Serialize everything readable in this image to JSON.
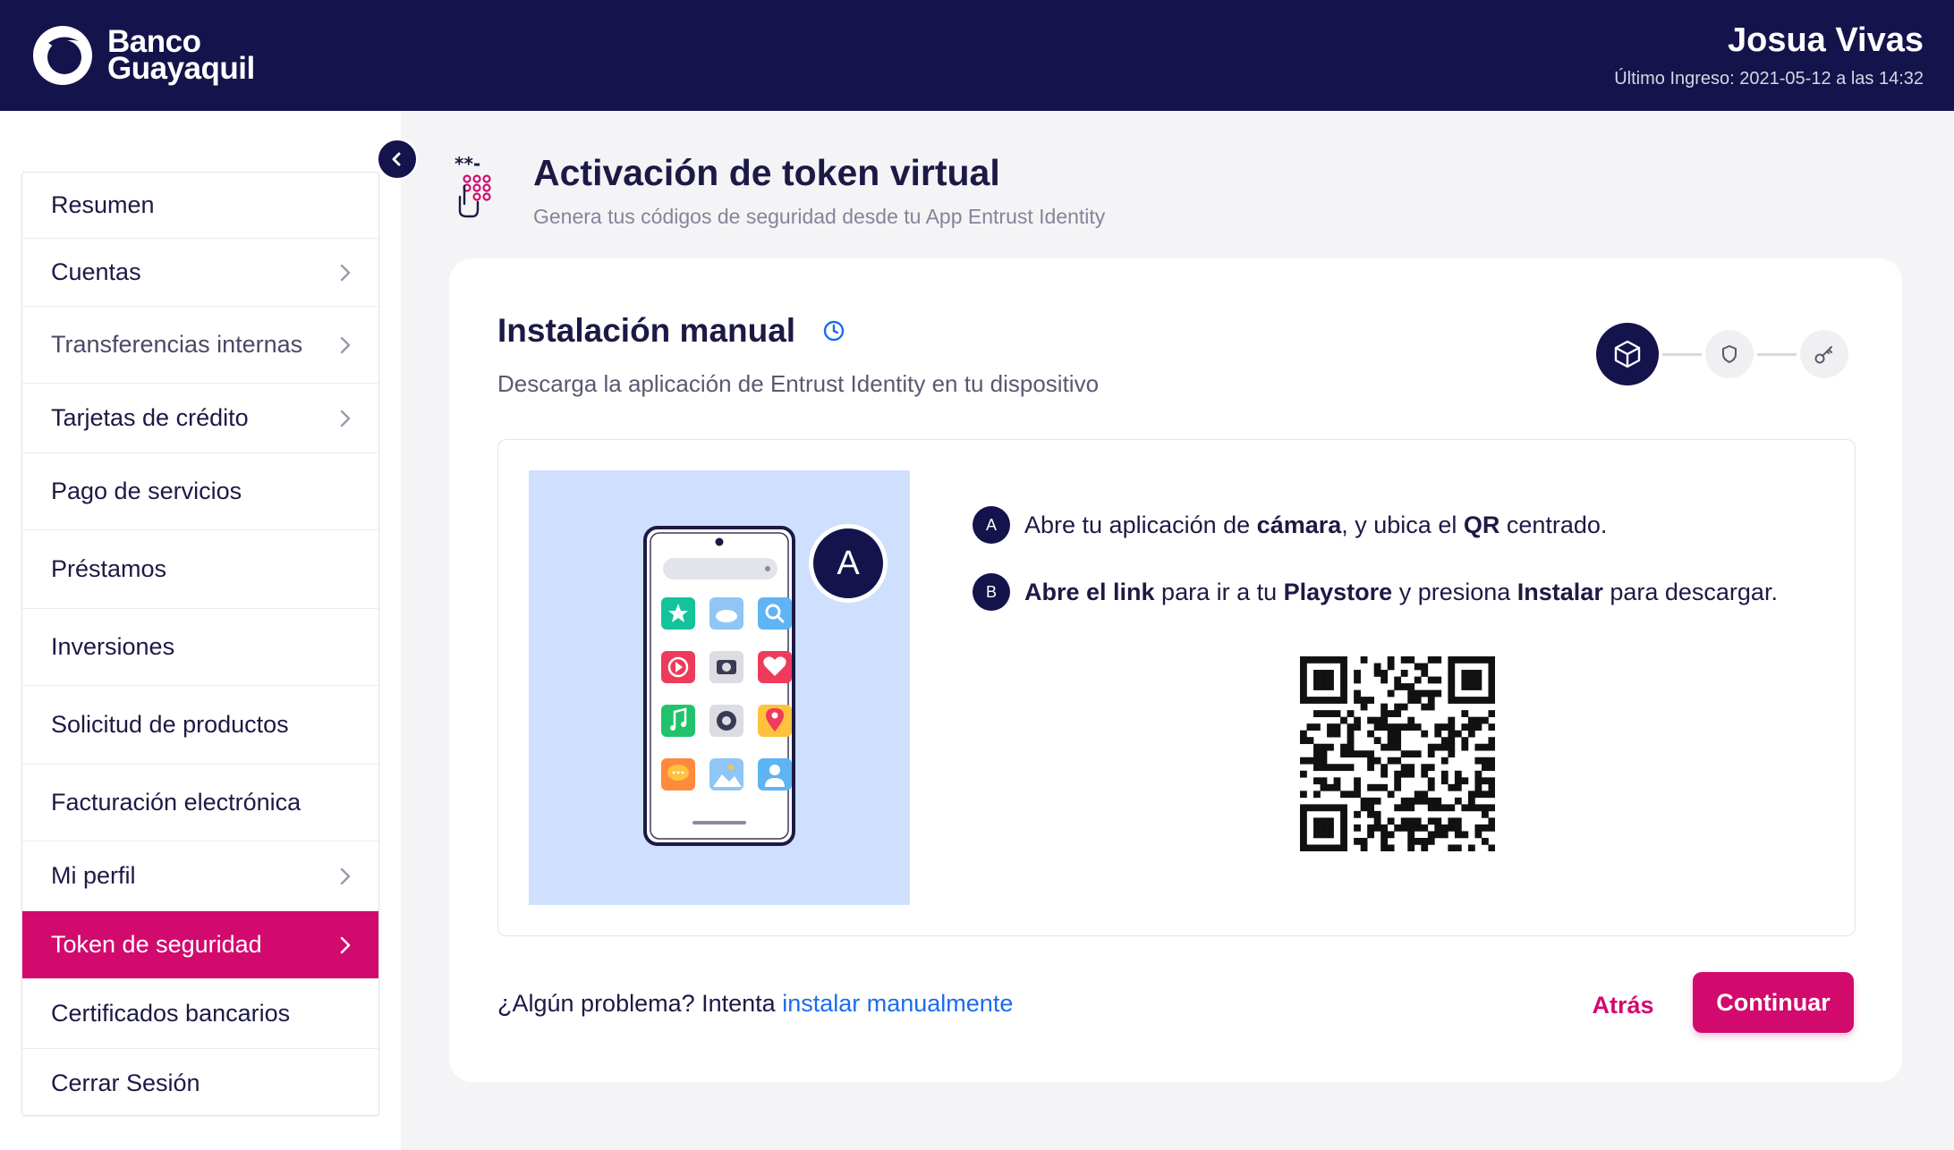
{
  "brand": {
    "line1": "Banco",
    "line2": "Guayaquil"
  },
  "user": {
    "name": "Josua Vivas",
    "last_login": "Último Ingreso: 2021-05-12 a las 14:32"
  },
  "sidebar": {
    "items": [
      {
        "label": "Resumen",
        "chevron": false,
        "active": false,
        "muted": false
      },
      {
        "label": "Cuentas",
        "chevron": true,
        "active": false,
        "muted": false
      },
      {
        "label": "Transferencias internas",
        "chevron": true,
        "active": false,
        "muted": true
      },
      {
        "label": "Tarjetas de crédito",
        "chevron": true,
        "active": false,
        "muted": false
      },
      {
        "label": "Pago de servicios",
        "chevron": false,
        "active": false,
        "muted": false
      },
      {
        "label": "Préstamos",
        "chevron": false,
        "active": false,
        "muted": false
      },
      {
        "label": "Inversiones",
        "chevron": false,
        "active": false,
        "muted": false
      },
      {
        "label": "Solicitud de productos",
        "chevron": false,
        "active": false,
        "muted": false
      },
      {
        "label": "Facturación electrónica",
        "chevron": false,
        "active": false,
        "muted": false
      },
      {
        "label": "Mi perfil",
        "chevron": true,
        "active": false,
        "muted": false
      },
      {
        "label": "Token de seguridad",
        "chevron": true,
        "active": true,
        "muted": false
      },
      {
        "label": "Certificados bancarios",
        "chevron": false,
        "active": false,
        "muted": false
      },
      {
        "label": "Cerrar Sesión",
        "chevron": false,
        "active": false,
        "muted": false
      }
    ]
  },
  "page": {
    "title": "Activación de token virtual",
    "subtitle": "Genera tus códigos de seguridad desde tu App Entrust Identity"
  },
  "card": {
    "title": "Instalación manual",
    "subtitle": "Descarga la aplicación de Entrust Identity en tu dispositivo",
    "illustration_badge": "A",
    "steps": [
      {
        "badge": "A",
        "parts": [
          {
            "t": "Abre tu aplicación de ",
            "b": false
          },
          {
            "t": "cámara",
            "b": true
          },
          {
            "t": ", y ubica el ",
            "b": false
          },
          {
            "t": "QR",
            "b": true
          },
          {
            "t": " centrado.",
            "b": false
          }
        ]
      },
      {
        "badge": "B",
        "parts": [
          {
            "t": "Abre el link",
            "b": true
          },
          {
            "t": " para ir a tu ",
            "b": false
          },
          {
            "t": "Playstore",
            "b": true
          },
          {
            "t": " y presiona ",
            "b": false
          },
          {
            "t": "Instalar",
            "b": true
          },
          {
            "t": " para descargar.",
            "b": false
          }
        ]
      }
    ]
  },
  "footer": {
    "problem_text": "¿Algún problema? Intenta ",
    "problem_link": "instalar manualmente",
    "back_label": "Atrás",
    "continue_label": "Continuar"
  },
  "colors": {
    "navy": "#15134b",
    "magenta": "#d20a6d",
    "link": "#1b6bf0",
    "illus_bg": "#cfe0ff"
  }
}
